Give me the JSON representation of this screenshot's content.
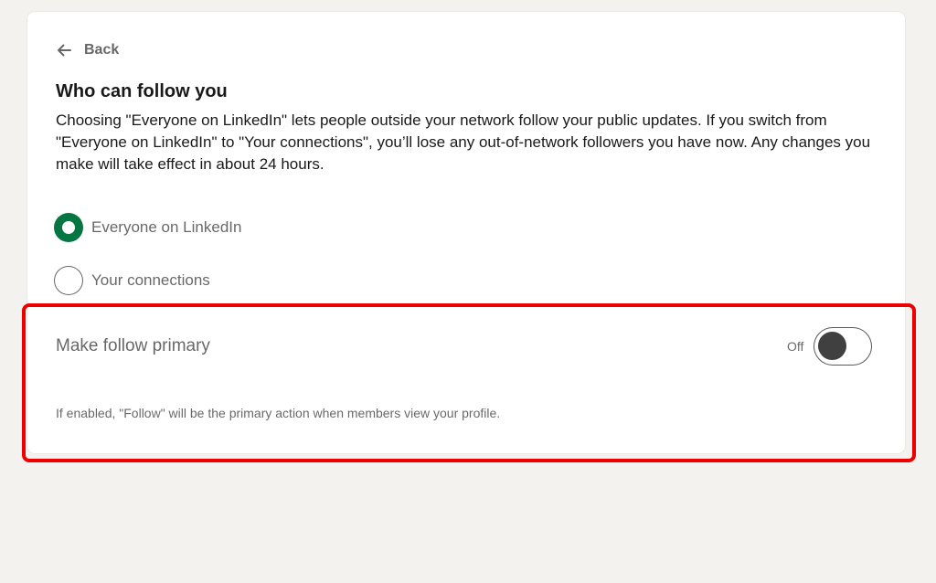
{
  "nav": {
    "back_label": "Back",
    "back_icon": "arrow-left-icon"
  },
  "section": {
    "title": "Who can follow you",
    "description": "Choosing \"Everyone on LinkedIn\" lets people outside your network follow your public updates. If you switch from \"Everyone on LinkedIn\" to \"Your connections\", you’ll lose any out-of-network followers you have now. Any changes you make will take effect in about 24 hours."
  },
  "options": [
    {
      "label": "Everyone on LinkedIn",
      "selected": true
    },
    {
      "label": "Your connections",
      "selected": false
    }
  ],
  "follow_primary": {
    "title": "Make follow primary",
    "state_label": "Off",
    "enabled": false,
    "help": "If enabled, \"Follow\" will be the primary action when members view your profile."
  },
  "colors": {
    "accent_green": "#057642",
    "highlight_red": "#ee0000",
    "page_background": "#f4f2ee",
    "card_background": "#ffffff"
  }
}
